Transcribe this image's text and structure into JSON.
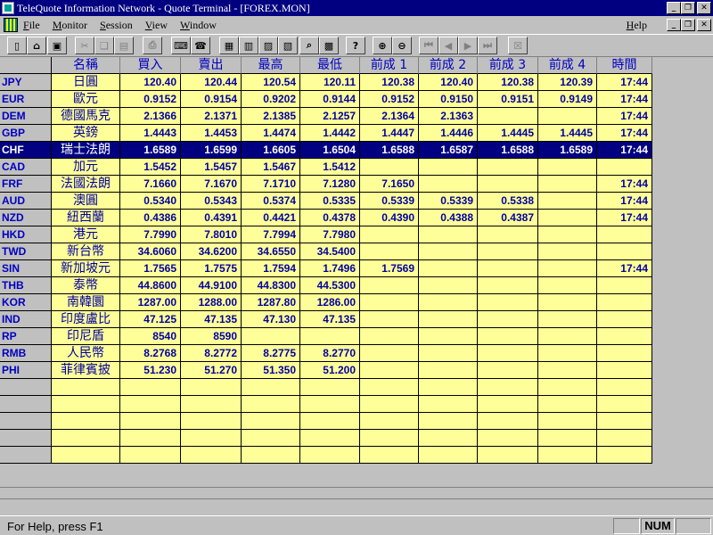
{
  "window": {
    "title": "TeleQuote Information Network - Quote Terminal - [FOREX.MON]"
  },
  "window_buttons": {
    "minimize": "_",
    "restore": "❐",
    "close": "✕"
  },
  "menu": {
    "items": [
      {
        "label": "File",
        "underline": "F",
        "rest": "ile"
      },
      {
        "label": "Monitor",
        "underline": "M",
        "rest": "onitor"
      },
      {
        "label": "Session",
        "underline": "S",
        "rest": "ession"
      },
      {
        "label": "View",
        "underline": "V",
        "rest": "iew"
      },
      {
        "label": "Window",
        "underline": "W",
        "rest": "indow"
      }
    ],
    "help": {
      "label": "Help",
      "underline": "H",
      "rest": "elp"
    }
  },
  "toolbar": {
    "buttons": [
      {
        "name": "new-file",
        "icon": "new-icon",
        "glyph": "▯"
      },
      {
        "name": "open-file",
        "icon": "folder-open-icon",
        "glyph": "⌂"
      },
      {
        "name": "save-file",
        "icon": "save-icon",
        "glyph": "▣"
      },
      {
        "name": "cut",
        "icon": "scissors-icon",
        "glyph": "✂",
        "disabled": true
      },
      {
        "name": "copy",
        "icon": "copy-icon",
        "glyph": "❏",
        "disabled": true
      },
      {
        "name": "paste",
        "icon": "paste-icon",
        "glyph": "▤",
        "disabled": true
      },
      {
        "name": "print",
        "icon": "printer-icon",
        "glyph": "⎙",
        "disabled": true
      },
      {
        "name": "keyboard",
        "icon": "keyboard-icon",
        "glyph": "⌨"
      },
      {
        "name": "phone",
        "icon": "phone-icon",
        "glyph": "☎"
      },
      {
        "name": "grid-view",
        "icon": "grid-icon",
        "glyph": "▦"
      },
      {
        "name": "chart-1",
        "icon": "chart-icon",
        "glyph": "▥"
      },
      {
        "name": "chart-2",
        "icon": "bar-chart-icon",
        "glyph": "▨"
      },
      {
        "name": "chart-3",
        "icon": "histogram-icon",
        "glyph": "▧"
      },
      {
        "name": "find",
        "icon": "find-icon",
        "glyph": "⌕"
      },
      {
        "name": "calculator",
        "icon": "calculator-icon",
        "glyph": "▩"
      },
      {
        "name": "help",
        "icon": "help-icon",
        "glyph": "?"
      },
      {
        "name": "zoom-in",
        "icon": "zoom-in-icon",
        "glyph": "⊕"
      },
      {
        "name": "zoom-out",
        "icon": "zoom-out-icon",
        "glyph": "⊖"
      },
      {
        "name": "first",
        "icon": "first-page-icon",
        "glyph": "⏮",
        "disabled": true
      },
      {
        "name": "prev",
        "icon": "prev-icon",
        "glyph": "◀",
        "disabled": true
      },
      {
        "name": "next",
        "icon": "next-icon",
        "glyph": "▶",
        "disabled": true
      },
      {
        "name": "last",
        "icon": "last-page-icon",
        "glyph": "⏭",
        "disabled": true
      },
      {
        "name": "close-window",
        "icon": "x-box-icon",
        "glyph": "☒",
        "disabled": true
      }
    ]
  },
  "table": {
    "columns": [
      "名稱",
      "買入",
      "賣出",
      "最高",
      "最低",
      "前成 1",
      "前成 2",
      "前成 3",
      "前成 4",
      "時間"
    ],
    "selected_row": 4,
    "rows": [
      {
        "code": "JPY",
        "cells": [
          "日圓",
          "120.40",
          "120.44",
          "120.54",
          "120.11",
          "120.38",
          "120.40",
          "120.38",
          "120.39",
          "17:44"
        ]
      },
      {
        "code": "EUR",
        "cells": [
          "歐元",
          "0.9152",
          "0.9154",
          "0.9202",
          "0.9144",
          "0.9152",
          "0.9150",
          "0.9151",
          "0.9149",
          "17:44"
        ]
      },
      {
        "code": "DEM",
        "cells": [
          "德國馬克",
          "2.1366",
          "2.1371",
          "2.1385",
          "2.1257",
          "2.1364",
          "2.1363",
          "",
          "",
          "17:44"
        ]
      },
      {
        "code": "GBP",
        "cells": [
          "英鎊",
          "1.4443",
          "1.4453",
          "1.4474",
          "1.4442",
          "1.4447",
          "1.4446",
          "1.4445",
          "1.4445",
          "17:44"
        ]
      },
      {
        "code": "CHF",
        "cells": [
          "瑞士法朗",
          "1.6589",
          "1.6599",
          "1.6605",
          "1.6504",
          "1.6588",
          "1.6587",
          "1.6588",
          "1.6589",
          "17:44"
        ]
      },
      {
        "code": "CAD",
        "cells": [
          "加元",
          "1.5452",
          "1.5457",
          "1.5467",
          "1.5412",
          "",
          "",
          "",
          "",
          ""
        ]
      },
      {
        "code": "FRF",
        "cells": [
          "法國法朗",
          "7.1660",
          "7.1670",
          "7.1710",
          "7.1280",
          "7.1650",
          "",
          "",
          "",
          "17:44"
        ]
      },
      {
        "code": "AUD",
        "cells": [
          "澳圓",
          "0.5340",
          "0.5343",
          "0.5374",
          "0.5335",
          "0.5339",
          "0.5339",
          "0.5338",
          "",
          "17:44"
        ]
      },
      {
        "code": "NZD",
        "cells": [
          "紐西蘭",
          "0.4386",
          "0.4391",
          "0.4421",
          "0.4378",
          "0.4390",
          "0.4388",
          "0.4387",
          "",
          "17:44"
        ]
      },
      {
        "code": "HKD",
        "cells": [
          "港元",
          "7.7990",
          "7.8010",
          "7.7994",
          "7.7980",
          "",
          "",
          "",
          "",
          ""
        ]
      },
      {
        "code": "TWD",
        "cells": [
          "新台幣",
          "34.6060",
          "34.6200",
          "34.6550",
          "34.5400",
          "",
          "",
          "",
          "",
          ""
        ]
      },
      {
        "code": "SIN",
        "cells": [
          "新加坡元",
          "1.7565",
          "1.7575",
          "1.7594",
          "1.7496",
          "1.7569",
          "",
          "",
          "",
          "17:44"
        ]
      },
      {
        "code": "THB",
        "cells": [
          "泰幣",
          "44.8600",
          "44.9100",
          "44.8300",
          "44.5300",
          "",
          "",
          "",
          "",
          ""
        ]
      },
      {
        "code": "KOR",
        "cells": [
          "南韓圜",
          "1287.00",
          "1288.00",
          "1287.80",
          "1286.00",
          "",
          "",
          "",
          "",
          ""
        ]
      },
      {
        "code": "IND",
        "cells": [
          "印度盧比",
          "47.125",
          "47.135",
          "47.130",
          "47.135",
          "",
          "",
          "",
          "",
          ""
        ]
      },
      {
        "code": "RP",
        "cells": [
          "印尼盾",
          "8540",
          "8590",
          "",
          "",
          "",
          "",
          "",
          "",
          ""
        ]
      },
      {
        "code": "RMB",
        "cells": [
          "人民幣",
          "8.2768",
          "8.2772",
          "8.2775",
          "8.2770",
          "",
          "",
          "",
          "",
          ""
        ]
      },
      {
        "code": "PHI",
        "cells": [
          "菲律賓披",
          "51.230",
          "51.270",
          "51.350",
          "51.200",
          "",
          "",
          "",
          "",
          ""
        ]
      },
      {
        "code": "",
        "cells": [
          "",
          "",
          "",
          "",
          "",
          "",
          "",
          "",
          "",
          ""
        ]
      },
      {
        "code": "",
        "cells": [
          "",
          "",
          "",
          "",
          "",
          "",
          "",
          "",
          "",
          ""
        ]
      },
      {
        "code": "",
        "cells": [
          "",
          "",
          "",
          "",
          "",
          "",
          "",
          "",
          "",
          ""
        ]
      },
      {
        "code": "",
        "cells": [
          "",
          "",
          "",
          "",
          "",
          "",
          "",
          "",
          "",
          ""
        ]
      },
      {
        "code": "",
        "cells": [
          "",
          "",
          "",
          "",
          "",
          "",
          "",
          "",
          "",
          ""
        ]
      }
    ]
  },
  "status": {
    "message": "For Help, press F1",
    "num": "NUM"
  },
  "colors": {
    "title_bg": "#000080",
    "cell_bg": "#ffff99",
    "text_blue": "#0000a0",
    "selected": "#000080"
  }
}
